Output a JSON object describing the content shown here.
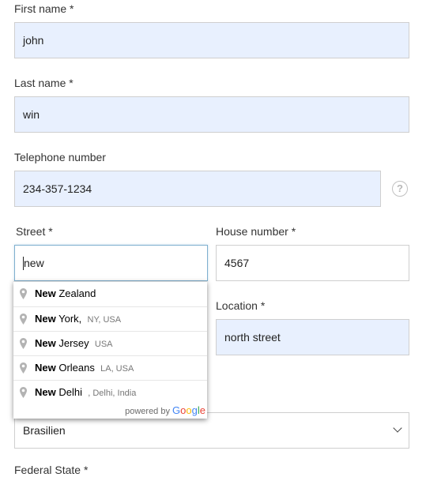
{
  "form": {
    "first_name": {
      "label": "First name *",
      "value": "john"
    },
    "last_name": {
      "label": "Last name *",
      "value": "win"
    },
    "telephone": {
      "label": "Telephone number",
      "value": "234-357-1234",
      "help_icon": "question-circle-icon"
    },
    "street": {
      "label": "Street  *",
      "value": "new"
    },
    "house_number": {
      "label": "House number *",
      "value": "4567"
    },
    "location": {
      "label": "Location *",
      "value": "north street"
    },
    "country_select": {
      "value": "Brasilien",
      "icon": "chevron-down-icon"
    },
    "federal_state": {
      "label": "Federal State *"
    }
  },
  "autocomplete": {
    "items": [
      {
        "match": "New",
        "rest": " Zealand",
        "secondary": ""
      },
      {
        "match": "New",
        "rest": " York,",
        "secondary": "NY, USA"
      },
      {
        "match": "New",
        "rest": " Jersey",
        "secondary": "USA"
      },
      {
        "match": "New",
        "rest": " Orleans",
        "secondary": "LA, USA"
      },
      {
        "match": "New",
        "rest": " Delhi",
        "secondary": ", Delhi, India"
      }
    ],
    "powered_by": "powered by",
    "logo_letters": [
      "G",
      "o",
      "o",
      "g",
      "l",
      "e"
    ]
  },
  "colors": {
    "autofill_bg": "#e8f0fe",
    "focus_border": "#7fb0cf",
    "google_blue": "#4285f4",
    "google_red": "#ea4335",
    "google_yellow": "#fbbc05",
    "google_green": "#34a853"
  }
}
